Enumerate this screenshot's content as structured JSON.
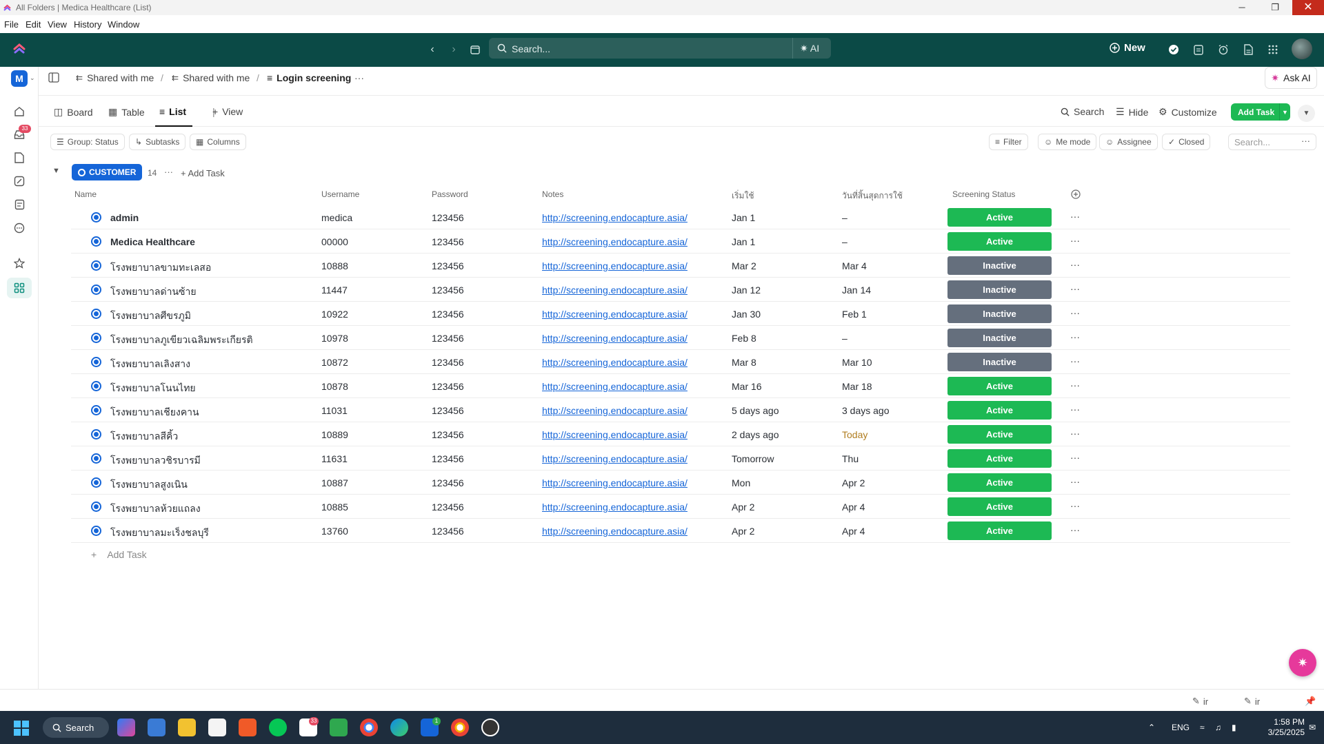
{
  "window": {
    "title": "All Folders | Medica Healthcare (List)",
    "minimize": "─",
    "restore": "❐",
    "close": "✕"
  },
  "menubar": [
    "File",
    "Edit",
    "View",
    "History",
    "Window"
  ],
  "topbar": {
    "search_placeholder": "Search...",
    "ai_label": "AI",
    "new_label": "New"
  },
  "rail": {
    "workspace_initial": "M",
    "inbox_badge": "33"
  },
  "breadcrumb": {
    "items": [
      "Shared with me",
      "Shared with me",
      "Login screening"
    ],
    "separator": "/",
    "more": "···",
    "ask_ai": "Ask AI"
  },
  "views": {
    "tabs": [
      "Board",
      "Table",
      "List"
    ],
    "active": "List",
    "add_view": "View",
    "actions": [
      "Search",
      "Hide",
      "Customize"
    ],
    "add_task": "Add Task"
  },
  "filters": {
    "left": [
      "Group: Status",
      "Subtasks",
      "Columns"
    ],
    "right": [
      "Filter",
      "Me mode",
      "Assignee",
      "Closed"
    ],
    "search_placeholder": "Search..."
  },
  "group": {
    "label": "CUSTOMER",
    "count": "14",
    "add_task": "Add Task"
  },
  "columns": [
    "Name",
    "Username",
    "Password",
    "Notes",
    "เริ่มใช้",
    "วันที่สิ้นสุดการใช้",
    "Screening Status"
  ],
  "rows": [
    {
      "name": "admin",
      "username": "medica",
      "password": "123456",
      "notes": "http://screening.endocapture.asia/",
      "start": "Jan 1",
      "end": "–",
      "status": "Active"
    },
    {
      "name": "Medica Healthcare",
      "username": "00000",
      "password": "123456",
      "notes": "http://screening.endocapture.asia/",
      "start": "Jan 1",
      "end": "–",
      "status": "Active"
    },
    {
      "name": "โรงพยาบาลขามทะเลสอ",
      "username": "10888",
      "password": "123456",
      "notes": "http://screening.endocapture.asia/",
      "start": "Mar 2",
      "end": "Mar 4",
      "status": "Inactive"
    },
    {
      "name": "โรงพยาบาลด่านซ้าย",
      "username": "11447",
      "password": "123456",
      "notes": "http://screening.endocapture.asia/",
      "start": "Jan 12",
      "end": "Jan 14",
      "status": "Inactive"
    },
    {
      "name": "โรงพยาบาลศีขรภูมิ",
      "username": "10922",
      "password": "123456",
      "notes": "http://screening.endocapture.asia/",
      "start": "Jan 30",
      "end": "Feb 1",
      "status": "Inactive"
    },
    {
      "name": "โรงพยาบาลภูเขียวเฉลิมพระเกียรติ",
      "username": "10978",
      "password": "123456",
      "notes": "http://screening.endocapture.asia/",
      "start": "Feb 8",
      "end": "–",
      "status": "Inactive"
    },
    {
      "name": "โรงพยาบาลเลิงสาง",
      "username": "10872",
      "password": "123456",
      "notes": "http://screening.endocapture.asia/",
      "start": "Mar 8",
      "end": "Mar 10",
      "status": "Inactive"
    },
    {
      "name": "โรงพยาบาลโนนไทย",
      "username": "10878",
      "password": "123456",
      "notes": "http://screening.endocapture.asia/",
      "start": "Mar 16",
      "end": "Mar 18",
      "status": "Active"
    },
    {
      "name": "โรงพยาบาลเชียงคาน",
      "username": "11031",
      "password": "123456",
      "notes": "http://screening.endocapture.asia/",
      "start": "5 days ago",
      "end": "3 days ago",
      "status": "Active"
    },
    {
      "name": "โรงพยาบาลสีคิ้ว",
      "username": "10889",
      "password": "123456",
      "notes": "http://screening.endocapture.asia/",
      "start": "2 days ago",
      "end": "Today",
      "status": "Active"
    },
    {
      "name": "โรงพยาบาลวชิรบารมี",
      "username": "11631",
      "password": "123456",
      "notes": "http://screening.endocapture.asia/",
      "start": "Tomorrow",
      "end": "Thu",
      "status": "Active"
    },
    {
      "name": "โรงพยาบาลสูงเนิน",
      "username": "10887",
      "password": "123456",
      "notes": "http://screening.endocapture.asia/",
      "start": "Mon",
      "end": "Apr 2",
      "status": "Active"
    },
    {
      "name": "โรงพยาบาลห้วยแถลง",
      "username": "10885",
      "password": "123456",
      "notes": "http://screening.endocapture.asia/",
      "start": "Apr 2",
      "end": "Apr 4",
      "status": "Active"
    },
    {
      "name": "โรงพยาบาลมะเร็งชลบุรี",
      "username": "13760",
      "password": "123456",
      "notes": "http://screening.endocapture.asia/",
      "start": "Apr 2",
      "end": "Apr 4",
      "status": "Active"
    }
  ],
  "add_task_row": "Add Task",
  "status_colors": {
    "Active": "#1db954",
    "Inactive": "#656f7d"
  },
  "today_color": "#b07d1f",
  "bottombar": {
    "left_doc": "ir",
    "right_doc": "ir"
  },
  "taskbar": {
    "search_label": "Search",
    "lang": "ENG",
    "time": "1:58 PM",
    "date": "3/25/2025",
    "app_badge": "33",
    "line_badge": "1"
  },
  "accent": "#0b4a46"
}
